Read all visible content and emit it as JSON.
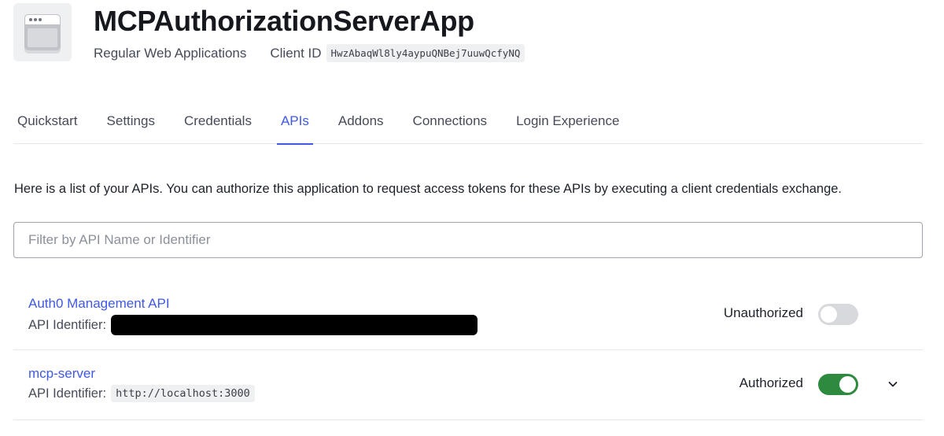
{
  "app": {
    "title": "MCPAuthorizationServerApp",
    "type": "Regular Web Applications",
    "client_id_label": "Client ID",
    "client_id": "HwzAbaqWl8ly4aypuQNBej7uuwQcfyNQ"
  },
  "tabs": [
    {
      "label": "Quickstart",
      "active": false
    },
    {
      "label": "Settings",
      "active": false
    },
    {
      "label": "Credentials",
      "active": false
    },
    {
      "label": "APIs",
      "active": true
    },
    {
      "label": "Addons",
      "active": false
    },
    {
      "label": "Connections",
      "active": false
    },
    {
      "label": "Login Experience",
      "active": false
    }
  ],
  "description": "Here is a list of your APIs. You can authorize this application to request access tokens for these APIs by executing a client credentials exchange.",
  "filter": {
    "placeholder": "Filter by API Name or Identifier",
    "value": ""
  },
  "apis": [
    {
      "name": "Auth0 Management API",
      "identifier_label": "API Identifier:",
      "identifier": "",
      "identifier_redacted": true,
      "status": "Unauthorized",
      "authorized": false
    },
    {
      "name": "mcp-server",
      "identifier_label": "API Identifier:",
      "identifier": "http://localhost:3000",
      "identifier_redacted": false,
      "status": "Authorized",
      "authorized": true,
      "expandable": true
    }
  ],
  "colors": {
    "accent": "#3f59e4",
    "toggle_on": "#2d8a3f",
    "toggle_off": "#d8d9dd"
  },
  "icons": {
    "app": "application-window-icon",
    "expand": "chevron-down-icon"
  }
}
